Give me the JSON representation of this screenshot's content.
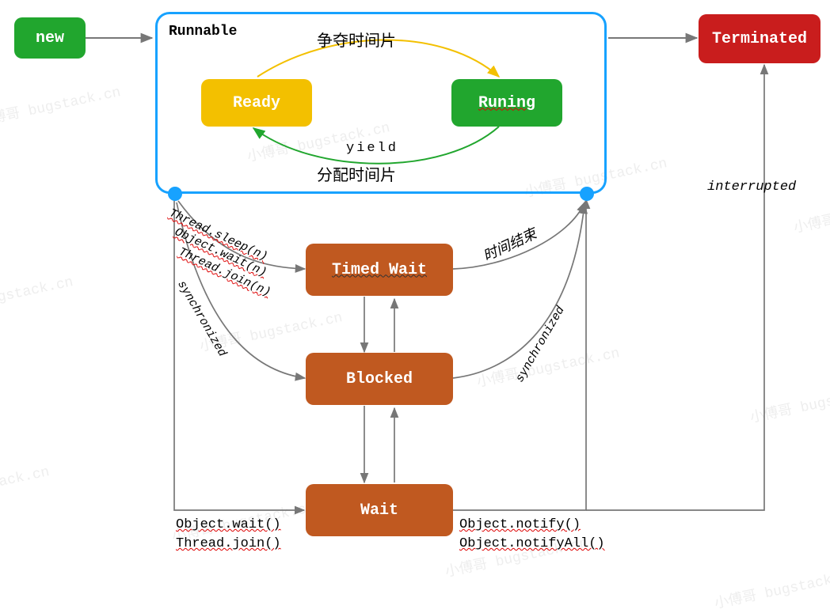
{
  "states": {
    "new": "new",
    "runnable": "Runnable",
    "ready": "Ready",
    "running": "Runing",
    "timed_wait": "Timed Wait",
    "blocked": "Blocked",
    "wait": "Wait",
    "terminated": "Terminated"
  },
  "edges": {
    "compete_slice": "争夺时间片",
    "yield": "yield",
    "allocate_slice": "分配时间片",
    "interrupted": "interrupted",
    "thread_sleep_n": "Thread.sleep(n)",
    "object_wait_n": "Object.wait(n)",
    "thread_join_n": "Thread.join(n)",
    "synchronized_left": "synchronized",
    "synchronized_right": "synchronized",
    "time_over": "时间结束",
    "object_wait": "Object.wait()",
    "thread_join": "Thread.join()",
    "object_notify": "Object.notify()",
    "object_notifyAll": "Object.notifyAll()"
  },
  "watermark": "小傅哥 bugstack.cn"
}
